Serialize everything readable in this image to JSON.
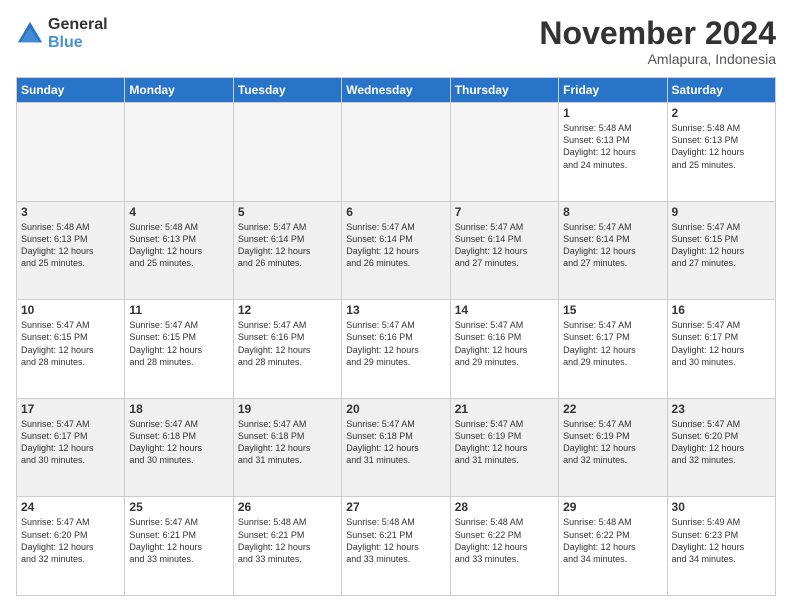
{
  "logo": {
    "line1": "General",
    "line2": "Blue"
  },
  "header": {
    "month": "November 2024",
    "location": "Amlapura, Indonesia"
  },
  "weekdays": [
    "Sunday",
    "Monday",
    "Tuesday",
    "Wednesday",
    "Thursday",
    "Friday",
    "Saturday"
  ],
  "weeks": [
    [
      {
        "day": "",
        "info": ""
      },
      {
        "day": "",
        "info": ""
      },
      {
        "day": "",
        "info": ""
      },
      {
        "day": "",
        "info": ""
      },
      {
        "day": "",
        "info": ""
      },
      {
        "day": "1",
        "info": "Sunrise: 5:48 AM\nSunset: 6:13 PM\nDaylight: 12 hours\nand 24 minutes."
      },
      {
        "day": "2",
        "info": "Sunrise: 5:48 AM\nSunset: 6:13 PM\nDaylight: 12 hours\nand 25 minutes."
      }
    ],
    [
      {
        "day": "3",
        "info": "Sunrise: 5:48 AM\nSunset: 6:13 PM\nDaylight: 12 hours\nand 25 minutes."
      },
      {
        "day": "4",
        "info": "Sunrise: 5:48 AM\nSunset: 6:13 PM\nDaylight: 12 hours\nand 25 minutes."
      },
      {
        "day": "5",
        "info": "Sunrise: 5:47 AM\nSunset: 6:14 PM\nDaylight: 12 hours\nand 26 minutes."
      },
      {
        "day": "6",
        "info": "Sunrise: 5:47 AM\nSunset: 6:14 PM\nDaylight: 12 hours\nand 26 minutes."
      },
      {
        "day": "7",
        "info": "Sunrise: 5:47 AM\nSunset: 6:14 PM\nDaylight: 12 hours\nand 27 minutes."
      },
      {
        "day": "8",
        "info": "Sunrise: 5:47 AM\nSunset: 6:14 PM\nDaylight: 12 hours\nand 27 minutes."
      },
      {
        "day": "9",
        "info": "Sunrise: 5:47 AM\nSunset: 6:15 PM\nDaylight: 12 hours\nand 27 minutes."
      }
    ],
    [
      {
        "day": "10",
        "info": "Sunrise: 5:47 AM\nSunset: 6:15 PM\nDaylight: 12 hours\nand 28 minutes."
      },
      {
        "day": "11",
        "info": "Sunrise: 5:47 AM\nSunset: 6:15 PM\nDaylight: 12 hours\nand 28 minutes."
      },
      {
        "day": "12",
        "info": "Sunrise: 5:47 AM\nSunset: 6:16 PM\nDaylight: 12 hours\nand 28 minutes."
      },
      {
        "day": "13",
        "info": "Sunrise: 5:47 AM\nSunset: 6:16 PM\nDaylight: 12 hours\nand 29 minutes."
      },
      {
        "day": "14",
        "info": "Sunrise: 5:47 AM\nSunset: 6:16 PM\nDaylight: 12 hours\nand 29 minutes."
      },
      {
        "day": "15",
        "info": "Sunrise: 5:47 AM\nSunset: 6:17 PM\nDaylight: 12 hours\nand 29 minutes."
      },
      {
        "day": "16",
        "info": "Sunrise: 5:47 AM\nSunset: 6:17 PM\nDaylight: 12 hours\nand 30 minutes."
      }
    ],
    [
      {
        "day": "17",
        "info": "Sunrise: 5:47 AM\nSunset: 6:17 PM\nDaylight: 12 hours\nand 30 minutes."
      },
      {
        "day": "18",
        "info": "Sunrise: 5:47 AM\nSunset: 6:18 PM\nDaylight: 12 hours\nand 30 minutes."
      },
      {
        "day": "19",
        "info": "Sunrise: 5:47 AM\nSunset: 6:18 PM\nDaylight: 12 hours\nand 31 minutes."
      },
      {
        "day": "20",
        "info": "Sunrise: 5:47 AM\nSunset: 6:18 PM\nDaylight: 12 hours\nand 31 minutes."
      },
      {
        "day": "21",
        "info": "Sunrise: 5:47 AM\nSunset: 6:19 PM\nDaylight: 12 hours\nand 31 minutes."
      },
      {
        "day": "22",
        "info": "Sunrise: 5:47 AM\nSunset: 6:19 PM\nDaylight: 12 hours\nand 32 minutes."
      },
      {
        "day": "23",
        "info": "Sunrise: 5:47 AM\nSunset: 6:20 PM\nDaylight: 12 hours\nand 32 minutes."
      }
    ],
    [
      {
        "day": "24",
        "info": "Sunrise: 5:47 AM\nSunset: 6:20 PM\nDaylight: 12 hours\nand 32 minutes."
      },
      {
        "day": "25",
        "info": "Sunrise: 5:47 AM\nSunset: 6:21 PM\nDaylight: 12 hours\nand 33 minutes."
      },
      {
        "day": "26",
        "info": "Sunrise: 5:48 AM\nSunset: 6:21 PM\nDaylight: 12 hours\nand 33 minutes."
      },
      {
        "day": "27",
        "info": "Sunrise: 5:48 AM\nSunset: 6:21 PM\nDaylight: 12 hours\nand 33 minutes."
      },
      {
        "day": "28",
        "info": "Sunrise: 5:48 AM\nSunset: 6:22 PM\nDaylight: 12 hours\nand 33 minutes."
      },
      {
        "day": "29",
        "info": "Sunrise: 5:48 AM\nSunset: 6:22 PM\nDaylight: 12 hours\nand 34 minutes."
      },
      {
        "day": "30",
        "info": "Sunrise: 5:49 AM\nSunset: 6:23 PM\nDaylight: 12 hours\nand 34 minutes."
      }
    ]
  ]
}
